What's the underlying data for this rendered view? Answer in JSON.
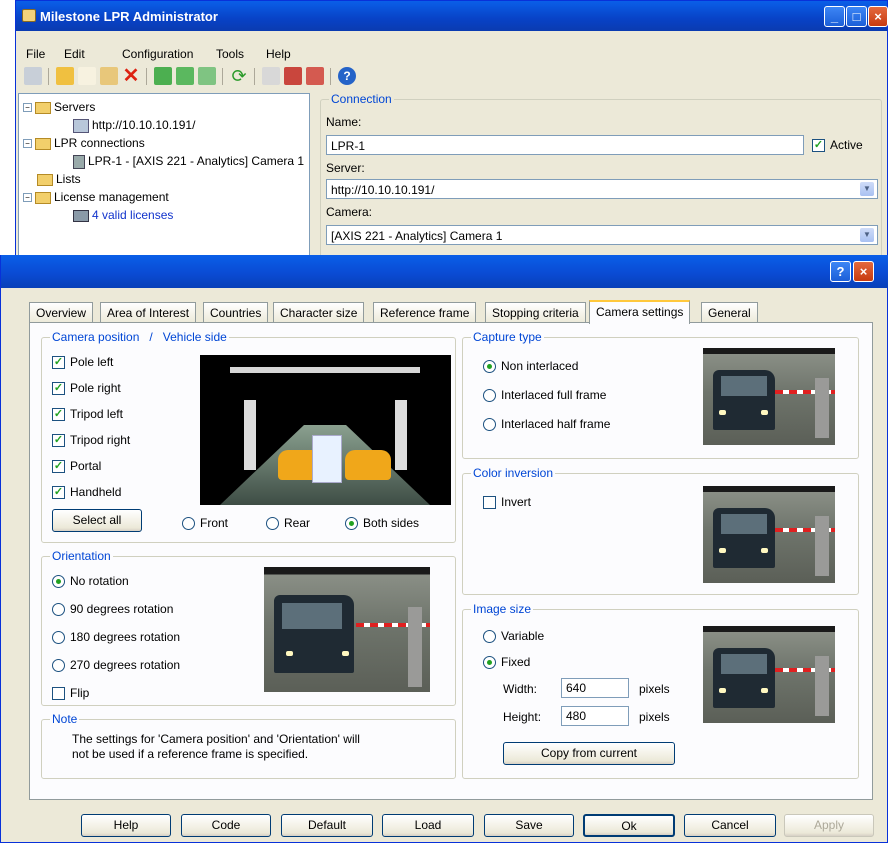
{
  "window": {
    "title": "Milestone LPR Administrator",
    "menu": [
      "File",
      "Edit",
      "Configuration",
      "Tools",
      "Help"
    ]
  },
  "tree": {
    "servers": "Servers",
    "server_url": "http://10.10.10.191/",
    "lpr_connections": "LPR connections",
    "lpr_item": "LPR-1 - [AXIS 221 - Analytics] Camera 1",
    "lists": "Lists",
    "license_management": "License management",
    "licenses": "4 valid licenses"
  },
  "connection": {
    "group": "Connection",
    "name_label": "Name:",
    "name_value": "LPR-1",
    "active_label": "Active",
    "server_label": "Server:",
    "server_value": "http://10.10.10.191/",
    "camera_label": "Camera:",
    "camera_value": "[AXIS 221 - Analytics] Camera 1"
  },
  "dialog": {
    "tabs": [
      "Overview",
      "Area of Interest",
      "Countries",
      "Character size",
      "Reference frame",
      "Stopping criteria",
      "Camera settings",
      "General"
    ],
    "active_tab": "Camera settings",
    "camera_position": {
      "label_a": "Camera position",
      "label_sep": "/",
      "label_b": "Vehicle side",
      "options": [
        "Pole left",
        "Pole right",
        "Tripod left",
        "Tripod right",
        "Portal",
        "Handheld"
      ],
      "select_all": "Select all",
      "sides": [
        "Front",
        "Rear",
        "Both sides"
      ],
      "selected_side": "Both sides"
    },
    "orientation": {
      "label": "Orientation",
      "options": [
        "No rotation",
        "90 degrees rotation",
        "180 degrees rotation",
        "270 degrees rotation"
      ],
      "selected": "No rotation",
      "flip": "Flip"
    },
    "note": {
      "label": "Note",
      "line1": "The settings for 'Camera position' and 'Orientation' will",
      "line2": "not be used if a reference frame is specified."
    },
    "capture_type": {
      "label": "Capture type",
      "options": [
        "Non interlaced",
        "Interlaced full frame",
        "Interlaced half frame"
      ],
      "selected": "Non interlaced"
    },
    "color_inversion": {
      "label": "Color inversion",
      "invert": "Invert"
    },
    "image_size": {
      "label": "Image size",
      "variable": "Variable",
      "fixed": "Fixed",
      "width_label": "Width:",
      "width_value": "640",
      "height_label": "Height:",
      "height_value": "480",
      "unit": "pixels",
      "copy_button": "Copy from current"
    },
    "buttons": [
      "Help",
      "Code",
      "Default",
      "Load",
      "Save",
      "Ok",
      "Cancel",
      "Apply"
    ]
  }
}
